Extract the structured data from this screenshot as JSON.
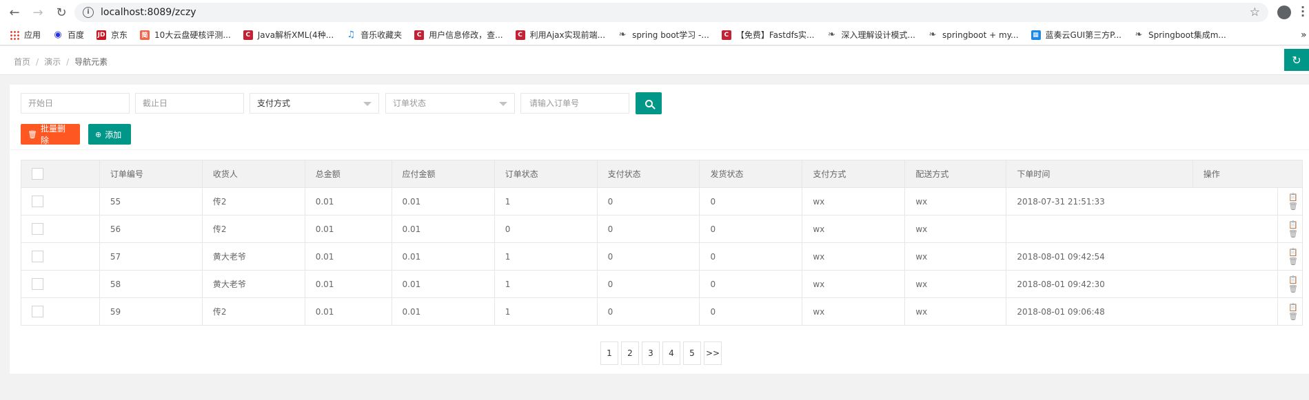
{
  "browser": {
    "url": "localhost:8089/zczy",
    "bookmarks": [
      {
        "label": "应用",
        "icon": "apps-grid-icon",
        "color": "#e94235"
      },
      {
        "label": "百度",
        "icon": "baidu-paw-icon",
        "color": "#2932e1"
      },
      {
        "label": "京东",
        "icon": "jd-icon",
        "color": "#c91623"
      },
      {
        "label": "10大云盘硬核评测...",
        "icon": "jian-icon",
        "color": "#f3644a"
      },
      {
        "label": "Java解析XML(4种...",
        "icon": "csdn-icon",
        "color": "#c32136"
      },
      {
        "label": "音乐收藏夹",
        "icon": "music-icon",
        "color": "#1f8ceb"
      },
      {
        "label": "用户信息修改，查...",
        "icon": "csdn-icon",
        "color": "#c32136"
      },
      {
        "label": "利用Ajax实现前端...",
        "icon": "csdn-icon",
        "color": "#c32136"
      },
      {
        "label": "spring boot学习 -...",
        "icon": "leaf-icon",
        "color": "#555555"
      },
      {
        "label": "【免费】Fastdfs实...",
        "icon": "csdn-icon",
        "color": "#c32136"
      },
      {
        "label": "深入理解设计模式...",
        "icon": "leaf-icon",
        "color": "#555555"
      },
      {
        "label": "springboot + my...",
        "icon": "leaf-icon",
        "color": "#555555"
      },
      {
        "label": "蓝奏云GUI第三方P...",
        "icon": "windows-icon",
        "color": "#1e88e5"
      },
      {
        "label": "Springboot集成m...",
        "icon": "leaf-icon",
        "color": "#555555"
      }
    ],
    "more": "»"
  },
  "breadcrumb": {
    "items": [
      "首页",
      "演示"
    ],
    "current": "导航元素",
    "separator": "/"
  },
  "filters": {
    "start_date_placeholder": "开始日",
    "end_date_placeholder": "截止日",
    "payment_method": "支付方式",
    "order_status": "订单状态",
    "order_no_placeholder": "请输入订单号"
  },
  "actions": {
    "batch_delete": "批量删除",
    "add": "添加"
  },
  "table": {
    "columns": [
      "订单编号",
      "收货人",
      "总金额",
      "应付金额",
      "订单状态",
      "支付状态",
      "发货状态",
      "支付方式",
      "配送方式",
      "下单时间",
      "操作"
    ],
    "rows": [
      [
        "55",
        "传2",
        "0.01",
        "0.01",
        "1",
        "0",
        "0",
        "wx",
        "wx",
        "2018-07-31 21:51:33"
      ],
      [
        "56",
        "传2",
        "0.01",
        "0.01",
        "0",
        "0",
        "0",
        "wx",
        "wx",
        ""
      ],
      [
        "57",
        "黄大老爷",
        "0.01",
        "0.01",
        "1",
        "0",
        "0",
        "wx",
        "wx",
        "2018-08-01 09:42:54"
      ],
      [
        "58",
        "黄大老爷",
        "0.01",
        "0.01",
        "1",
        "0",
        "0",
        "wx",
        "wx",
        "2018-08-01 09:42:30"
      ],
      [
        "59",
        "传2",
        "0.01",
        "0.01",
        "1",
        "0",
        "0",
        "wx",
        "wx",
        "2018-08-01 09:06:48"
      ]
    ]
  },
  "pagination": {
    "pages": [
      "1",
      "2",
      "3",
      "4",
      "5"
    ],
    "next": ">>"
  },
  "colors": {
    "primary": "#009688",
    "danger": "#ff5722"
  }
}
